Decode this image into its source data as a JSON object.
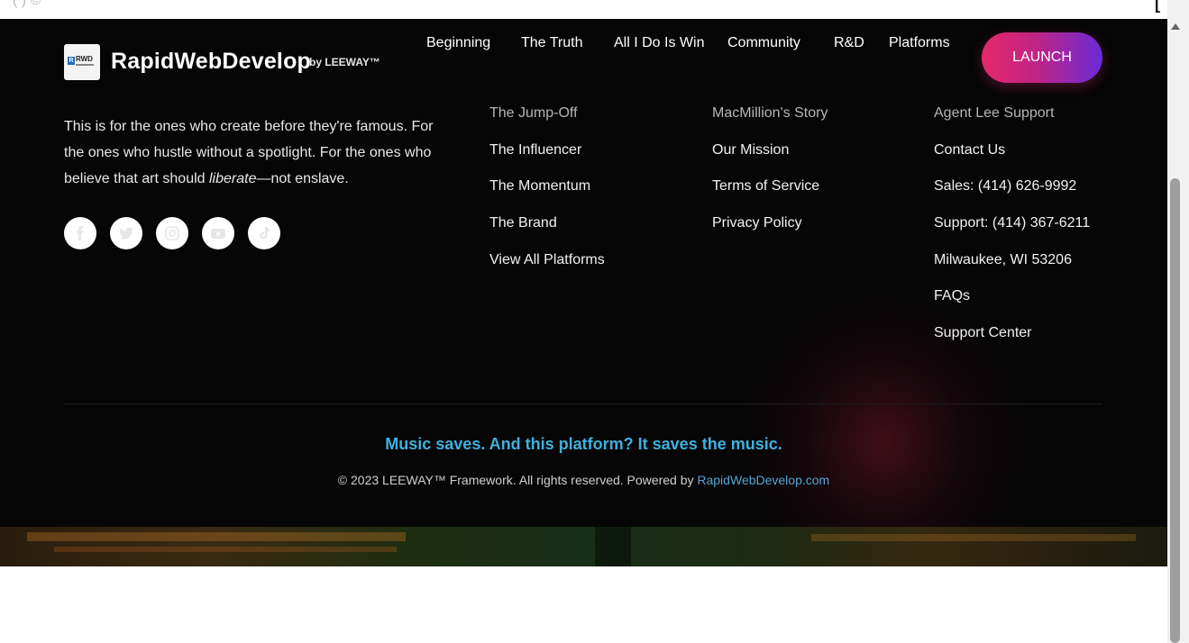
{
  "brand": {
    "name": "RapidWebDevelop",
    "by": "by LEEWAY™",
    "logo_text": "RWD"
  },
  "nav": [
    "Beginning",
    "The Truth",
    "All I Do Is Win",
    "Community",
    "R&D",
    "Platforms"
  ],
  "launch_label": "LAUNCH",
  "about": {
    "text_before": "This is for the ones who create before they're famous. For the ones who hustle without a spotlight. For the ones who believe that art should ",
    "text_em": "liberate",
    "text_after": "—not enslave."
  },
  "social_icons": [
    "facebook-icon",
    "twitter-icon",
    "instagram-icon",
    "youtube-icon",
    "tiktok-icon"
  ],
  "columns": [
    {
      "items": [
        "The Jump-Off",
        "The Influencer",
        "The Momentum",
        "The Brand",
        "View All Platforms"
      ]
    },
    {
      "items": [
        "MacMillion's Story",
        "Our Mission",
        "Terms of Service",
        "Privacy Policy"
      ]
    },
    {
      "items": [
        "Agent Lee Support",
        "Contact Us",
        "Sales: (414) 626-9992",
        "Support: (414) 367-6211",
        "Milwaukee, WI 53206",
        "FAQs",
        "Support Center"
      ]
    }
  ],
  "tagline": "Music saves. And this platform? It saves the music.",
  "copyright": {
    "text": "© 2023 LEEWAY™ Framework. All rights reserved. Powered by ",
    "link": "RapidWebDevelop.com"
  },
  "colors": {
    "accent_blue": "#3fb1e0",
    "launch_gradient_start": "#e6286b",
    "launch_gradient_end": "#6a2bd8",
    "background": "#060606"
  }
}
